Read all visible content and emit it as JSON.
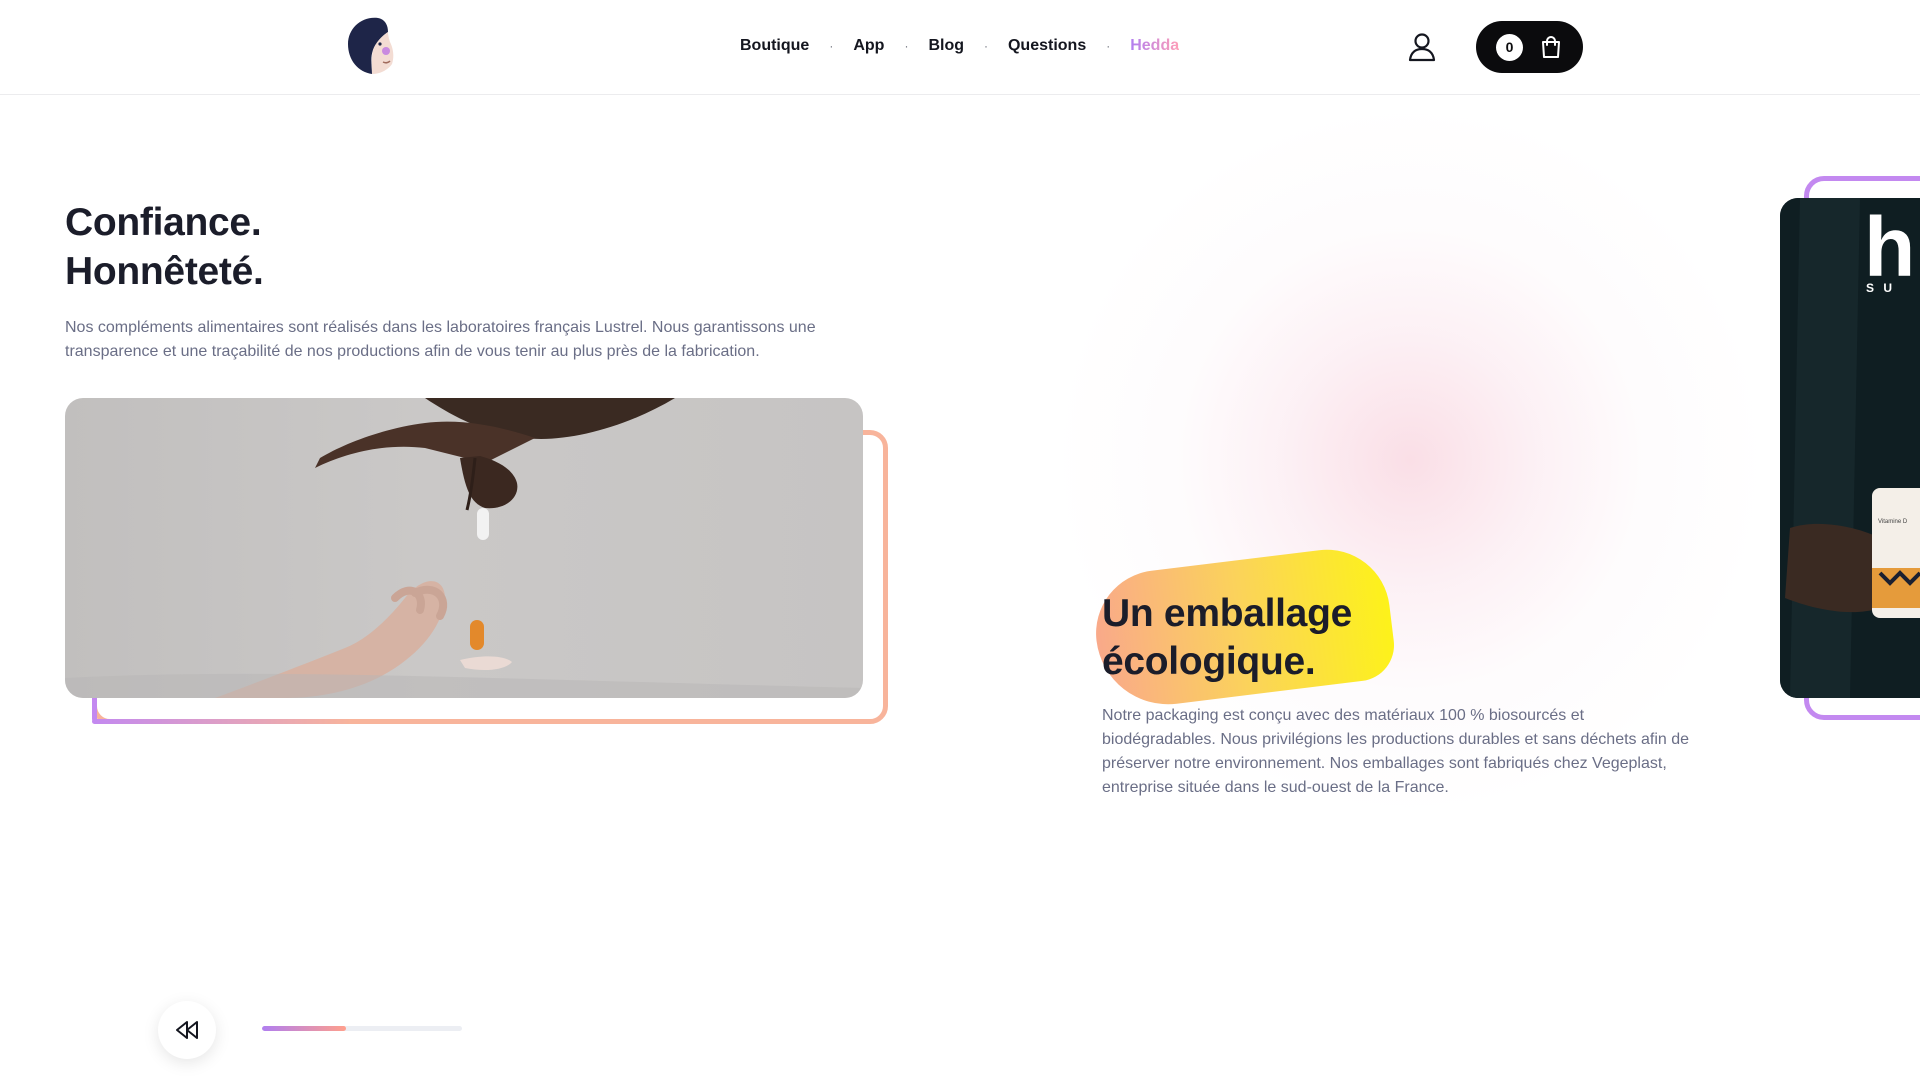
{
  "header": {
    "nav": [
      {
        "label": "Boutique"
      },
      {
        "label": "App"
      },
      {
        "label": "Blog"
      },
      {
        "label": "Questions"
      },
      {
        "label": "Hedda"
      }
    ],
    "nav_separator": "·",
    "cart_count": "0",
    "icons": {
      "logo": "avatar-logo",
      "user": "user-icon",
      "cart": "shopping-bag-icon"
    }
  },
  "feature_1": {
    "title_line_1": "Confiance.",
    "title_line_2": "Honnêteté.",
    "text": "Nos compléments alimentaires sont réalisés dans les laboratoires français Lustrel. Nous garantissons une transparence et une traçabilité de nos productions afin de vous tenir au plus près de la fabrication."
  },
  "feature_2": {
    "title_line_1": "Un emballage",
    "title_line_2": "écologique.",
    "text": "Notre packaging est conçu avec des matériaux 100 % biosourcés et biodégradables. Nous privilégions les productions durables et sans déchets afin de préserver notre environnement. Nos emballages sont fabriqués chez Vegeplast, entreprise située dans le sud-ouest de la France."
  },
  "card": {
    "logo_text": "h",
    "sub_text": "S U",
    "product_label": "Vitamine D"
  },
  "slider": {
    "progress": 0.42,
    "rewind_icon": "rewind-icon"
  },
  "colors": {
    "text_dark": "#1b1d2a",
    "text_muted": "#6a6e86",
    "accent_purple": "#c389f0",
    "accent_peach": "#f8b49b",
    "accent_yellow": "#fdf21a",
    "cart_bg": "#0b0b0d"
  }
}
